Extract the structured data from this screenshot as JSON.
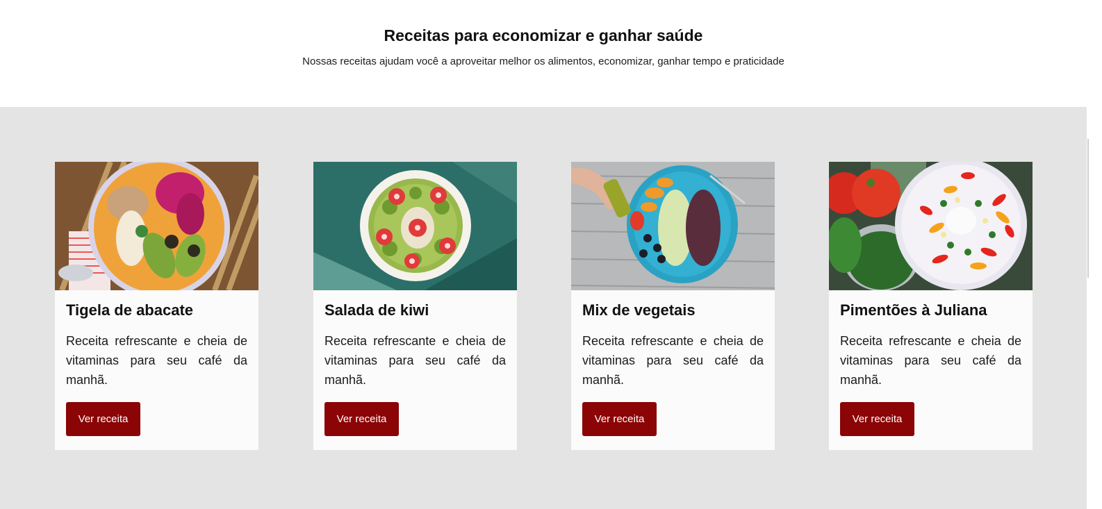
{
  "hero": {
    "title": "Receitas para economizar e ganhar saúde",
    "subtitle": "Nossas receitas ajudam você a aproveitar melhor os alimentos, economizar, ganhar tempo e praticidade"
  },
  "cards": [
    {
      "title": "Tigela de abacate",
      "description": "Receita refrescante e cheia de vitaminas para seu café da manhã.",
      "button_label": "Ver receita",
      "image": "avocado-bowl-photo"
    },
    {
      "title": "Salada de kiwi",
      "description": "Receita refrescante e cheia de vitaminas para seu café da manhã.",
      "button_label": "Ver receita",
      "image": "kiwi-salad-photo"
    },
    {
      "title": "Mix de vegetais",
      "description": "Receita refrescante e cheia de vitaminas para seu café da manhã.",
      "button_label": "Ver receita",
      "image": "vegetable-mix-photo"
    },
    {
      "title": "Pimentões à Juliana",
      "description": "Receita refrescante e cheia de vitaminas para seu café da manhã.",
      "button_label": "Ver receita",
      "image": "julienne-peppers-photo"
    }
  ],
  "colors": {
    "button_bg": "#8b0406",
    "section_bg": "#e4e4e4",
    "card_bg": "#fbfbfb"
  }
}
